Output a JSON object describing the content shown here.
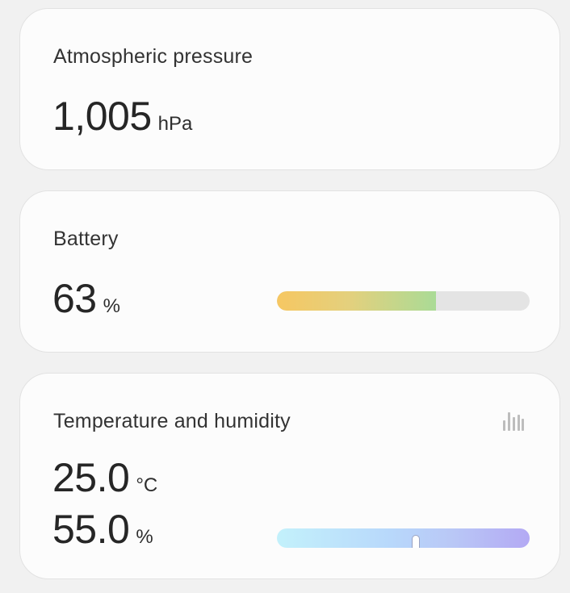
{
  "pressure": {
    "title": "Atmospheric pressure",
    "value": "1,005",
    "unit": "hPa"
  },
  "battery": {
    "title": "Battery",
    "value": "63",
    "unit": "%",
    "level_percent": 63,
    "gradient_colors": [
      "#f6c762",
      "#e4d07d",
      "#aadb96"
    ],
    "track_color": "#e4e4e4"
  },
  "temp_humidity": {
    "title": "Temperature and humidity",
    "temperature": {
      "value": "25.0",
      "unit": "°C"
    },
    "humidity": {
      "value": "55.0",
      "unit": "%",
      "level_percent": 55
    },
    "history_icon": "bar-chart-icon",
    "gradient_colors": [
      "#c3f1fb",
      "#b8d8fb",
      "#b9c7f6",
      "#b3a9f4"
    ]
  }
}
